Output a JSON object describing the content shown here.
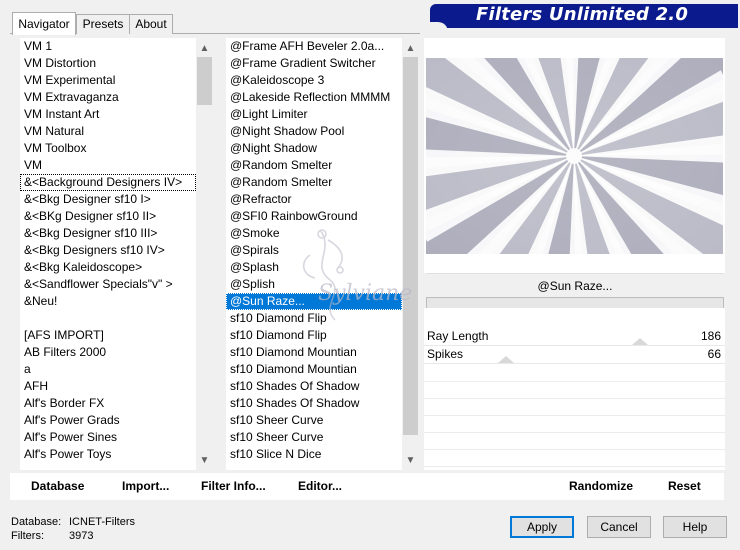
{
  "header": {
    "title": "Filters Unlimited 2.0"
  },
  "tabs": [
    {
      "label": "Navigator",
      "active": true
    },
    {
      "label": "Presets",
      "active": false
    },
    {
      "label": "About",
      "active": false
    }
  ],
  "categories": [
    "VM 1",
    "VM Distortion",
    "VM Experimental",
    "VM Extravaganza",
    "VM Instant Art",
    "VM Natural",
    "VM Toolbox",
    "VM",
    "&<Background Designers IV>",
    "&<Bkg Designer sf10 I>",
    "&<BKg Designer sf10 II>",
    "&<Bkg Designer sf10 III>",
    "&<Bkg Designers sf10 IV>",
    "&<Bkg Kaleidoscope>",
    "&<Sandflower Specials\"v\" >",
    "&Neu!",
    "",
    "[AFS IMPORT]",
    "AB Filters 2000",
    "a",
    "AFH",
    "Alf's Border FX",
    "Alf's Power Grads",
    "Alf's Power Sines",
    "Alf's Power Toys"
  ],
  "categories_selected_index": 8,
  "filters": [
    "@Frame AFH Beveler 2.0a...",
    "@Frame Gradient Switcher",
    "@Kaleidoscope 3",
    "@Lakeside Reflection MMMM",
    "@Light Limiter",
    "@Night Shadow Pool",
    "@Night Shadow",
    "@Random Smelter",
    "@Random Smelter",
    "@Refractor",
    "@SFI0 RainbowGround",
    "@Smoke",
    "@Spirals",
    "@Splash",
    "@Splish",
    "@Sun Raze...",
    "sf10 Diamond Flip",
    "sf10 Diamond Flip",
    "sf10 Diamond Mountian",
    "sf10 Diamond Mountian",
    "sf10 Shades Of Shadow",
    "sf10 Shades Of Shadow",
    "sf10 Sheer Curve",
    "sf10 Sheer Curve",
    "sf10 Slice N Dice"
  ],
  "filters_selected_index": 15,
  "watermark_text": "Sylviane",
  "preview": {
    "filter_name": "@Sun Raze..."
  },
  "params": [
    {
      "label": "Ray Length",
      "value": "186",
      "level": 0.73
    },
    {
      "label": "Spikes",
      "value": "66",
      "level": 0.26
    }
  ],
  "toolbar": {
    "database_label": "Database",
    "import_label": "Import...",
    "filter_info_label": "Filter Info...",
    "editor_label": "Editor...",
    "randomize_label": "Randomize",
    "reset_label": "Reset"
  },
  "status": {
    "database_label": "Database:",
    "database_value": "ICNET-Filters",
    "filters_label": "Filters:",
    "filters_value": "3973"
  },
  "buttons": {
    "apply": "Apply",
    "cancel": "Cancel",
    "help": "Help"
  },
  "colors": {
    "banner": "#0b1b8e",
    "selection": "#0078d7"
  }
}
